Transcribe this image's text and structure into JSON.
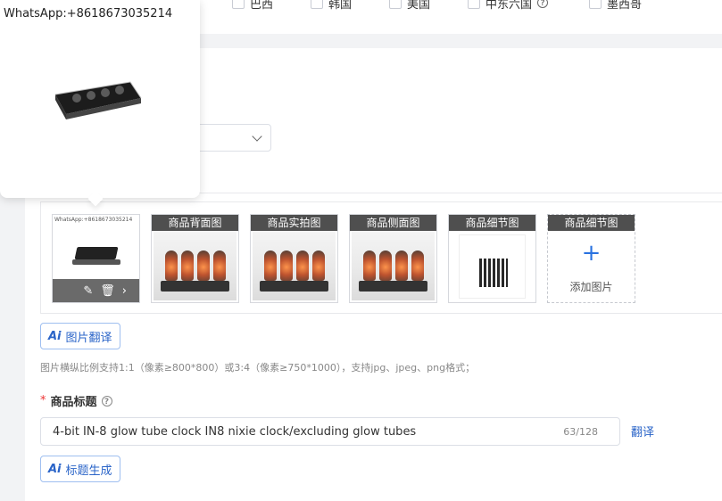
{
  "regions": [
    {
      "label": "巴西",
      "has_help": false
    },
    {
      "label": "韩国",
      "has_help": false
    },
    {
      "label": "美国",
      "has_help": false
    },
    {
      "label": "中东六国",
      "has_help": true
    },
    {
      "label": "墨西哥",
      "has_help": false
    }
  ],
  "popover": {
    "watermark": "WhatsApp:+8618673035214"
  },
  "cover": {
    "watermark": "WhatsApp:+8618673035214"
  },
  "image_slots": [
    {
      "label": "商品背面图"
    },
    {
      "label": "商品实拍图"
    },
    {
      "label": "商品侧面图"
    },
    {
      "label": "商品细节图"
    },
    {
      "label": "商品细节图"
    }
  ],
  "add_image_label": "添加图片",
  "image_translate_button": "图片翻译",
  "image_hint": "图片横纵比例支持1:1（像素≥800*800）或3:4（像素≥750*1000），支持jpg、jpeg、png格式；",
  "title_field": {
    "required_mark": "*",
    "label": "商品标题",
    "value": "4-bit IN-8 glow tube clock IN8 nixie clock/excluding glow tubes",
    "counter": "63/128",
    "translate_link": "翻译"
  },
  "title_generate_button": "标题生成",
  "ai_icon_text": "Ai"
}
